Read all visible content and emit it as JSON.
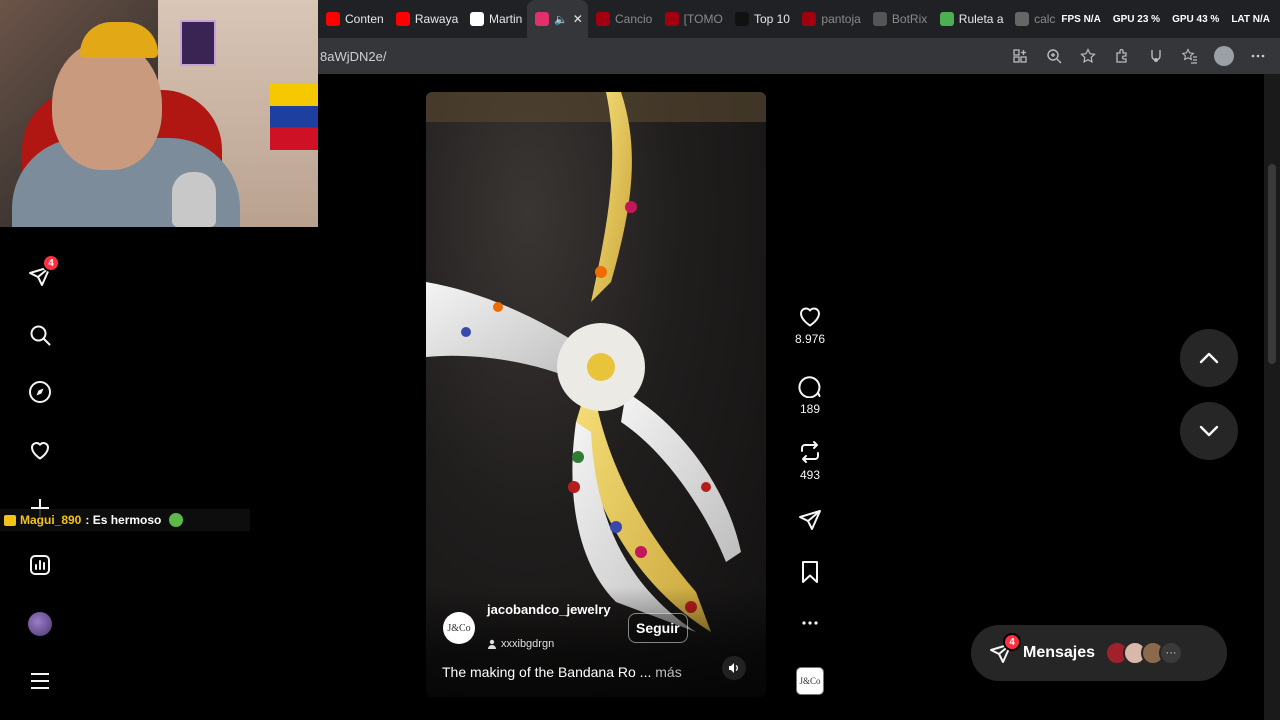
{
  "browser": {
    "tabs": [
      {
        "label": "Conten",
        "color": "#ff0000",
        "active": false
      },
      {
        "label": "Rawaya",
        "color": "#ff0000",
        "active": false
      },
      {
        "label": "Martin",
        "color": "#ffffff",
        "active": false
      },
      {
        "label": "",
        "color": "#e1306c",
        "active": true,
        "speaker": true,
        "close": "✕"
      },
      {
        "label": "Cancio",
        "color": "#a00010",
        "active": false,
        "dim": true
      },
      {
        "label": "[TOMO",
        "color": "#a00010",
        "active": false,
        "dim": true
      },
      {
        "label": "Top 10",
        "color": "#111111",
        "active": false
      },
      {
        "label": "pantoja",
        "color": "#a00010",
        "active": false,
        "dim": true
      },
      {
        "label": "BotRix",
        "color": "#555555",
        "active": false,
        "dim": true
      },
      {
        "label": "Ruleta a",
        "color": "#4caf50",
        "active": false
      },
      {
        "label": "calc",
        "color": "#666666",
        "active": false,
        "dim": true
      }
    ],
    "stats": [
      "FPS N/A",
      "GPU 23 %",
      "GPU 43 %",
      "LAT N/A"
    ],
    "url": "8aWjDN2e/"
  },
  "chat": {
    "username": "Magui_890",
    "message": ": Es hermoso"
  },
  "nav": {
    "notifications_badge": "4"
  },
  "reel": {
    "owner_avatar_text": "J&Co",
    "owner_name": "jacobandco_jewelry",
    "owner_sub": "xxxibgdrgn",
    "follow_label": "Seguir",
    "caption": "The making of the Bandana Ro ...",
    "caption_more": "más"
  },
  "actions": {
    "likes": "8.976",
    "comments": "189",
    "reposts": "493",
    "audio_thumb_text": "J&Co"
  },
  "messages": {
    "label": "Mensajes",
    "badge": "4",
    "avatars": [
      "#a0202c",
      "#d8b8a8",
      "#8a6a4a"
    ],
    "more": "···"
  }
}
